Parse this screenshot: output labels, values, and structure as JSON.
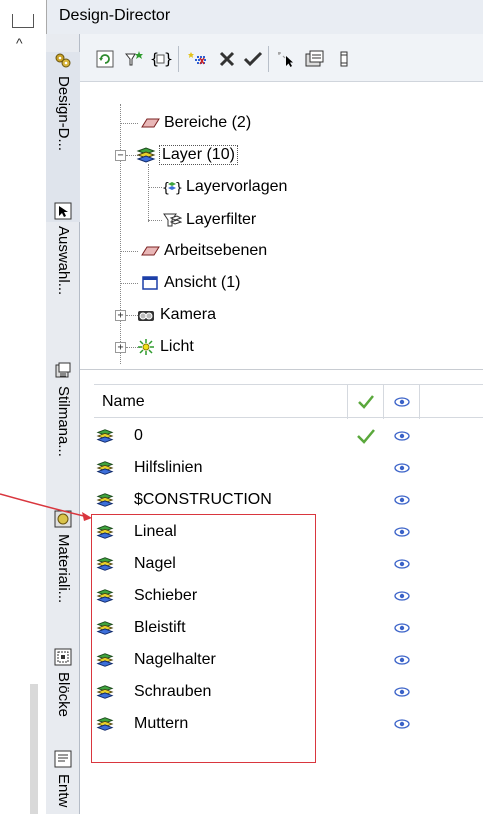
{
  "window": {
    "title": "Design-Director"
  },
  "vertical_tabs": [
    {
      "label": "Design-D...",
      "icon": "design-director-icon",
      "active": true
    },
    {
      "label": "Auswahl...",
      "icon": "cursor-select-icon"
    },
    {
      "label": "Stilmana...",
      "icon": "style-manager-icon"
    },
    {
      "label": "Materiali...",
      "icon": "material-icon"
    },
    {
      "label": "Blöcke",
      "icon": "blocks-icon"
    },
    {
      "label": "Entw",
      "icon": "drafts-icon"
    }
  ],
  "toolbar": [
    {
      "icon": "refresh-icon"
    },
    {
      "icon": "filter-star-icon"
    },
    {
      "icon": "brace-template-icon"
    },
    {
      "icon": "new-layer-icon"
    },
    {
      "icon": "delete-icon"
    },
    {
      "icon": "set-current-icon"
    },
    {
      "icon": "select-objects-icon"
    },
    {
      "icon": "properties-icon"
    },
    {
      "icon": "more-tools-icon"
    }
  ],
  "tree": {
    "items": [
      {
        "label": "Bereiche (2)",
        "icon": "plane-icon"
      },
      {
        "label": "Layer (10)",
        "icon": "layer-stack-icon",
        "expanded": true,
        "selected": true
      },
      {
        "label": "Layervorlagen",
        "icon": "layer-template-icon"
      },
      {
        "label": "Layerfilter",
        "icon": "layer-filter-icon"
      },
      {
        "label": "Arbeitsebenen",
        "icon": "plane-icon"
      },
      {
        "label": "Ansicht (1)",
        "icon": "view-window-icon"
      },
      {
        "label": "Kamera",
        "icon": "camera-icon"
      },
      {
        "label": "Licht",
        "icon": "light-icon"
      }
    ]
  },
  "list": {
    "columns": {
      "name": "Name",
      "current": "✔",
      "visible": "👁"
    },
    "rows": [
      {
        "name": "0",
        "current": true
      },
      {
        "name": "Hilfslinien",
        "current": false
      },
      {
        "name": "$CONSTRUCTION",
        "current": false
      },
      {
        "name": "Lineal",
        "current": false
      },
      {
        "name": "Nagel",
        "current": false
      },
      {
        "name": "Schieber",
        "current": false
      },
      {
        "name": "Bleistift",
        "current": false
      },
      {
        "name": "Nagelhalter",
        "current": false
      },
      {
        "name": "Schrauben",
        "current": false
      },
      {
        "name": "Muttern",
        "current": false
      }
    ]
  },
  "colors": {
    "annotation": "#d9363e",
    "check_green": "#5aa83c",
    "eye_blue": "#3a62c8"
  }
}
